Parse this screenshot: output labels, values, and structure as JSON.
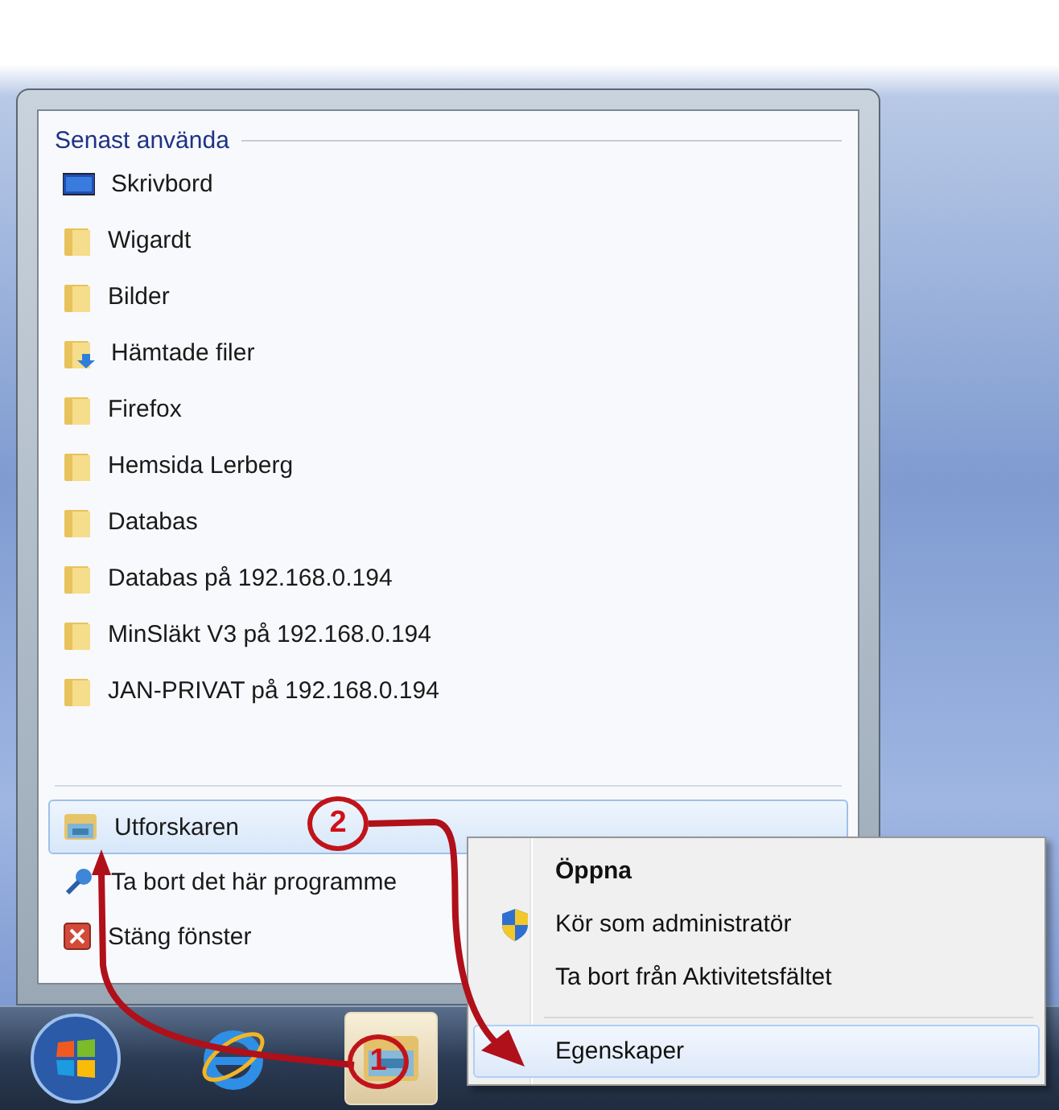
{
  "jump_list": {
    "section_title": "Senast använda",
    "recent_items": [
      {
        "label": "Skrivbord",
        "kind": "desktop"
      },
      {
        "label": "Wigardt",
        "kind": "folder"
      },
      {
        "label": "Bilder",
        "kind": "folder"
      },
      {
        "label": "Hämtade filer",
        "kind": "downloads"
      },
      {
        "label": "Firefox",
        "kind": "folder"
      },
      {
        "label": "Hemsida Lerberg",
        "kind": "folder"
      },
      {
        "label": "Databas",
        "kind": "folder"
      },
      {
        "label": "Databas på 192.168.0.194",
        "kind": "folder"
      },
      {
        "label": "MinSläkt V3 på 192.168.0.194",
        "kind": "folder"
      },
      {
        "label": "JAN-PRIVAT på 192.168.0.194",
        "kind": "folder"
      }
    ],
    "tasks": [
      {
        "label": "Utforskaren",
        "kind": "explorer",
        "selected": true
      },
      {
        "label": "Ta bort det här programme",
        "kind": "unpin",
        "selected": false
      },
      {
        "label": "Stäng fönster",
        "kind": "close",
        "selected": false
      }
    ]
  },
  "context_menu": {
    "items": [
      {
        "label": "Öppna",
        "kind": "default",
        "selected": false
      },
      {
        "label": "Kör som administratör",
        "kind": "admin",
        "selected": false
      },
      {
        "label": "Ta bort från Aktivitetsfältet",
        "kind": "plain",
        "selected": false
      },
      {
        "label": "Egenskaper",
        "kind": "after_separator",
        "selected": true
      }
    ]
  },
  "taskbar": {
    "buttons": [
      {
        "kind": "start",
        "selected": false
      },
      {
        "kind": "browser",
        "selected": false
      },
      {
        "kind": "explorer",
        "selected": true
      }
    ]
  },
  "annotations": [
    {
      "number": "2",
      "kind": "menu"
    },
    {
      "number": "1",
      "kind": "taskbar"
    }
  ]
}
